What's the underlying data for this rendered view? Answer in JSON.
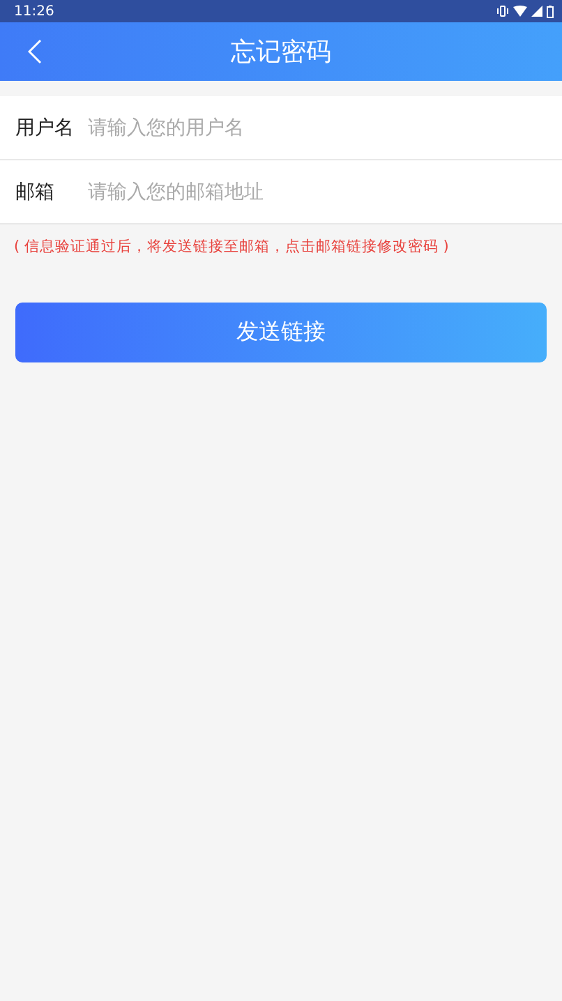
{
  "status_bar": {
    "time": "11:26"
  },
  "header": {
    "title": "忘记密码"
  },
  "fields": [
    {
      "label": "用户名",
      "placeholder": "请输入您的用户名"
    },
    {
      "label": "邮箱",
      "placeholder": "请输入您的邮箱地址"
    }
  ],
  "note": "( 信息验证通过后，将发送链接至邮箱，点击邮箱链接修改密码 )",
  "submit_button": "发送链接"
}
